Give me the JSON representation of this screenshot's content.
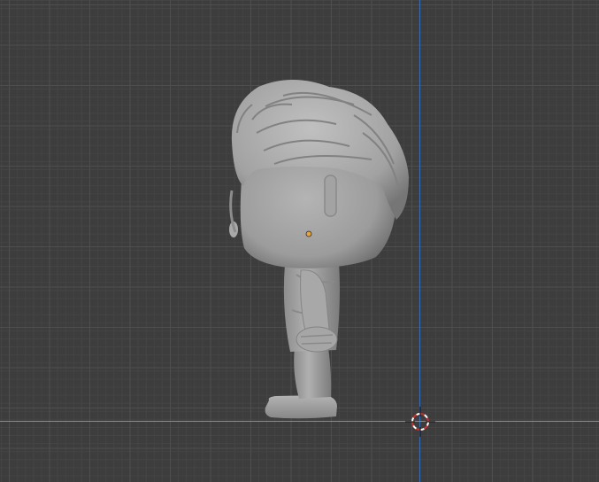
{
  "viewport": {
    "view": "right-orthographic",
    "background": "#3d3d3d",
    "grid": true,
    "axis_colors": {
      "z": "#3b6fb5",
      "y": "#7aa52d"
    },
    "origin_color": "#e8a33a",
    "cursor_colors": [
      "#d0302c",
      "#ffffff"
    ],
    "model": {
      "name": "vinyl-figure",
      "shading": "solid",
      "color": "#a3a3a3"
    }
  }
}
